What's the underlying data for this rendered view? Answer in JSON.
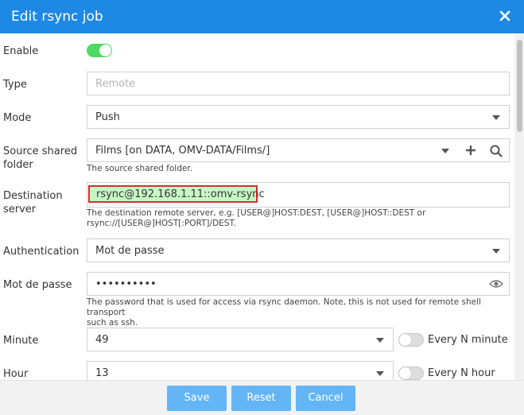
{
  "dialog": {
    "title": "Edit rsync job"
  },
  "form": {
    "enable": {
      "label": "Enable",
      "on": true
    },
    "type": {
      "label": "Type",
      "placeholder": "Remote"
    },
    "mode": {
      "label": "Mode",
      "value": "Push"
    },
    "source": {
      "label_line1": "Source shared",
      "label_line2": "folder",
      "value": "Films [on DATA, OMV-DATA/Films/]",
      "help": "The source shared folder."
    },
    "destination": {
      "label_line1": "Destination",
      "label_line2": "server",
      "value": "rsync@192.168.1.11::omv-rsync",
      "help_line1": "The destination remote server, e.g. [USER@]HOST:DEST, [USER@]HOST::DEST or",
      "help_line2": "rsync://[USER@]HOST[:PORT]/DEST."
    },
    "authentication": {
      "label": "Authentication",
      "value": "Mot de passe"
    },
    "password": {
      "label": "Mot de passe",
      "value": "••••••••••",
      "help_line1": "The password that is used for access via rsync daemon. Note, this is not used for remote shell transport",
      "help_line2": "such as ssh."
    },
    "minute": {
      "label": "Minute",
      "value": "49",
      "toggle_label": "Every N minute",
      "toggle_on": false
    },
    "hour": {
      "label": "Hour",
      "value": "13",
      "toggle_label": "Every N hour",
      "toggle_on": false
    }
  },
  "footer": {
    "save_label": "Save",
    "reset_label": "Reset",
    "cancel_label": "Cancel"
  },
  "colors": {
    "titlebar": "#1e88e5",
    "button": "#64b5f6",
    "toggle_on": "#4cd964",
    "highlight_fill": "#c8f7c5",
    "highlight_border": "#d32f2f"
  },
  "icons": [
    "close-icon",
    "chevron-down-icon",
    "plus-icon",
    "search-icon",
    "eye-icon"
  ]
}
